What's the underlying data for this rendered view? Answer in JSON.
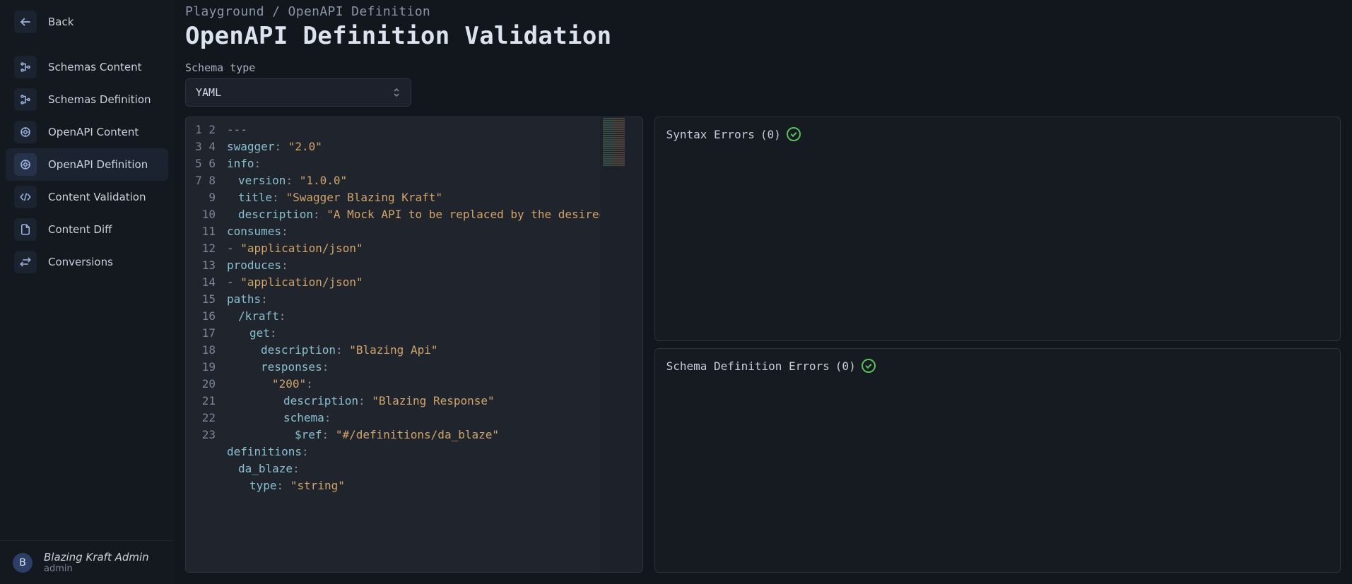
{
  "sidebar": {
    "back_label": "Back",
    "items": [
      {
        "label": "Schemas Content",
        "icon": "schema-content-icon"
      },
      {
        "label": "Schemas Definition",
        "icon": "schema-definition-icon"
      },
      {
        "label": "OpenAPI Content",
        "icon": "openapi-content-icon"
      },
      {
        "label": "OpenAPI Definition",
        "icon": "openapi-definition-icon"
      },
      {
        "label": "Content Validation",
        "icon": "code-brackets-icon"
      },
      {
        "label": "Content Diff",
        "icon": "file-diff-icon"
      },
      {
        "label": "Conversions",
        "icon": "swap-icon"
      }
    ],
    "active_index": 3
  },
  "user": {
    "avatar_letter": "B",
    "name": "Blazing Kraft Admin",
    "role": "admin"
  },
  "breadcrumb": "Playground / OpenAPI Definition",
  "page_title": "OpenAPI Definition Validation",
  "schema_type": {
    "label": "Schema type",
    "value": "YAML"
  },
  "editor": {
    "lines": [
      [
        [
          "mark",
          "---"
        ]
      ],
      [
        [
          "key",
          "swagger"
        ],
        [
          "colon",
          ":"
        ],
        [
          "sp",
          " "
        ],
        [
          "str",
          "\"2.0\""
        ]
      ],
      [
        [
          "key",
          "info"
        ],
        [
          "colon",
          ":"
        ]
      ],
      [
        [
          "ind",
          1
        ],
        [
          "key",
          "version"
        ],
        [
          "colon",
          ":"
        ],
        [
          "sp",
          " "
        ],
        [
          "str",
          "\"1.0.0\""
        ]
      ],
      [
        [
          "ind",
          1
        ],
        [
          "key",
          "title"
        ],
        [
          "colon",
          ":"
        ],
        [
          "sp",
          " "
        ],
        [
          "str",
          "\"Swagger Blazing Kraft\""
        ]
      ],
      [
        [
          "ind",
          1
        ],
        [
          "key",
          "description"
        ],
        [
          "colon",
          ":"
        ],
        [
          "sp",
          " "
        ],
        [
          "str",
          "\"A Mock API to be replaced by the desired"
        ]
      ],
      [
        [
          "key",
          "consumes"
        ],
        [
          "colon",
          ":"
        ]
      ],
      [
        [
          "mark",
          "- "
        ],
        [
          "str",
          "\"application/json\""
        ]
      ],
      [
        [
          "key",
          "produces"
        ],
        [
          "colon",
          ":"
        ]
      ],
      [
        [
          "mark",
          "- "
        ],
        [
          "str",
          "\"application/json\""
        ]
      ],
      [
        [
          "key",
          "paths"
        ],
        [
          "colon",
          ":"
        ]
      ],
      [
        [
          "ind",
          1
        ],
        [
          "key",
          "/kraft"
        ],
        [
          "colon",
          ":"
        ]
      ],
      [
        [
          "ind",
          2
        ],
        [
          "key",
          "get"
        ],
        [
          "colon",
          ":"
        ]
      ],
      [
        [
          "ind",
          3
        ],
        [
          "key",
          "description"
        ],
        [
          "colon",
          ":"
        ],
        [
          "sp",
          " "
        ],
        [
          "str",
          "\"Blazing Api\""
        ]
      ],
      [
        [
          "ind",
          3
        ],
        [
          "key",
          "responses"
        ],
        [
          "colon",
          ":"
        ]
      ],
      [
        [
          "ind",
          4
        ],
        [
          "str",
          "\"200\""
        ],
        [
          "colon",
          ":"
        ]
      ],
      [
        [
          "ind",
          5
        ],
        [
          "key",
          "description"
        ],
        [
          "colon",
          ":"
        ],
        [
          "sp",
          " "
        ],
        [
          "str",
          "\"Blazing Response\""
        ]
      ],
      [
        [
          "ind",
          5
        ],
        [
          "key",
          "schema"
        ],
        [
          "colon",
          ":"
        ]
      ],
      [
        [
          "ind",
          6
        ],
        [
          "key",
          "$ref"
        ],
        [
          "colon",
          ":"
        ],
        [
          "sp",
          " "
        ],
        [
          "str",
          "\"#/definitions/da_blaze\""
        ]
      ],
      [
        [
          "key",
          "definitions"
        ],
        [
          "colon",
          ":"
        ]
      ],
      [
        [
          "ind",
          1
        ],
        [
          "key",
          "da_blaze"
        ],
        [
          "colon",
          ":"
        ]
      ],
      [
        [
          "ind",
          2
        ],
        [
          "key",
          "type"
        ],
        [
          "colon",
          ":"
        ],
        [
          "sp",
          " "
        ],
        [
          "str",
          "\"string\""
        ]
      ],
      []
    ]
  },
  "errors": {
    "syntax": {
      "label": "Syntax Errors",
      "count": "(0)"
    },
    "schema": {
      "label": "Schema Definition Errors",
      "count": "(0)"
    }
  }
}
